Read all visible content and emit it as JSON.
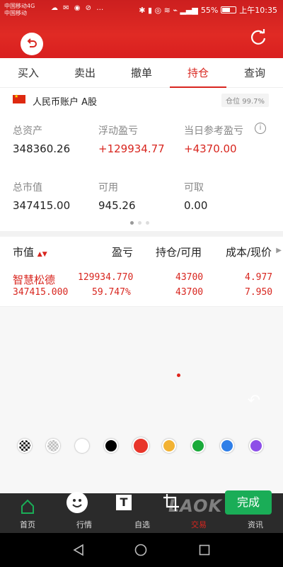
{
  "status_bar": {
    "carrier_1": "中国移动4G",
    "carrier_2": "中国移动",
    "battery": "55%",
    "time": "上午10:35"
  },
  "tabs": [
    {
      "label": "买入"
    },
    {
      "label": "卖出"
    },
    {
      "label": "撤单"
    },
    {
      "label": "持仓",
      "active": true
    },
    {
      "label": "查询"
    }
  ],
  "account": {
    "name": "人民币账户 A股",
    "position_label": "仓位 99.7%"
  },
  "stats": {
    "total_assets_label": "总资产",
    "total_assets": "348360.26",
    "floating_pl_label": "浮动盈亏",
    "floating_pl": "+129934.77",
    "daily_pl_label": "当日参考盈亏",
    "daily_pl": "+4370.00",
    "market_value_label": "总市值",
    "market_value": "347415.00",
    "available_label": "可用",
    "available": "945.26",
    "withdrawable_label": "可取",
    "withdrawable": "0.00"
  },
  "holdings": {
    "headers": {
      "market_value": "市值",
      "profit": "盈亏",
      "position": "持仓/可用",
      "cost": "成本/现价"
    },
    "rows": [
      {
        "name": "智慧松德",
        "market_value": "347415.000",
        "profit": "129934.770",
        "profit_pct": "59.747%",
        "position": "43700",
        "available": "43700",
        "cost": "4.977",
        "price": "7.950"
      }
    ]
  },
  "palette": {
    "colors": [
      "#ffffff",
      "#000000",
      "#e8352a",
      "#f2b233",
      "#1aaa3a",
      "#2f7fe8",
      "#8d4fe8"
    ]
  },
  "bottom_tabs": {
    "home": "首页",
    "quotes": "行情",
    "watchlist": "自选",
    "trade": "交易",
    "news": "资讯"
  },
  "editor": {
    "text_tool": "T",
    "done": "完成"
  },
  "watermark": "LAOK"
}
